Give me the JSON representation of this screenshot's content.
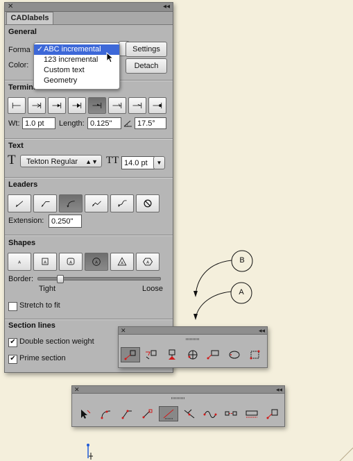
{
  "panel": {
    "tab_label": "CADlabels",
    "general": {
      "title": "General",
      "format_label": "Forma",
      "color_label": "Color:",
      "settings_button": "Settings",
      "detach_button": "Detach",
      "format_menu": {
        "items": [
          "ABC incremental",
          "123 incremental",
          "Custom text",
          "Geometry"
        ],
        "selected_index": 0,
        "check": "✓"
      }
    },
    "terminators": {
      "title": "Terminators",
      "wt_label": "Wt:",
      "wt_value": "1.0 pt",
      "length_label": "Length:",
      "length_value": "0.125\"",
      "angle_value": "17.5°",
      "selected_index": 4
    },
    "text": {
      "title": "Text",
      "font_value": "Tekton Regular",
      "size_value": "14.0 pt"
    },
    "leaders": {
      "title": "Leaders",
      "extension_label": "Extension:",
      "extension_value": "0.250\"",
      "selected_index": 2
    },
    "shapes": {
      "title": "Shapes",
      "shape_letter": "A",
      "border_label": "Border:",
      "tight_label": "Tight",
      "loose_label": "Loose",
      "border_value_fraction": 0.18,
      "stretch_label": "Stretch to fit",
      "stretch_checked": false,
      "selected_index": 3
    },
    "section_lines": {
      "title": "Section lines",
      "double_weight_label": "Double section weight",
      "double_weight_checked": true,
      "prime_label": "Prime section",
      "prime_checked": true
    }
  },
  "canvas": {
    "balloon_b": "B",
    "balloon_a": "A"
  },
  "colors": {
    "panel_bg": "#b6b6b6",
    "canvas_bg": "#f4efdc",
    "menu_highlight": "#3d68d8",
    "tool_red": "#d11a1a"
  }
}
